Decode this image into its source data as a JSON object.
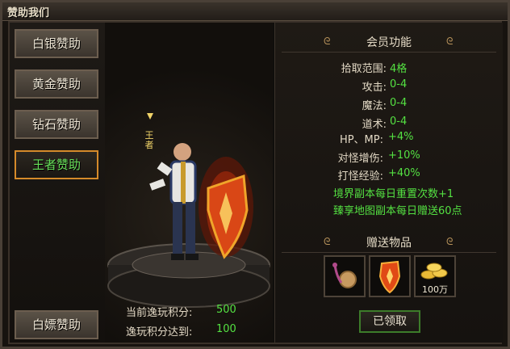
{
  "window": {
    "title": "赞助我们"
  },
  "tiers": [
    {
      "label": "白银赞助",
      "active": false
    },
    {
      "label": "黄金赞助",
      "active": false
    },
    {
      "label": "钻石赞助",
      "active": false
    },
    {
      "label": "王者赞助",
      "active": true
    }
  ],
  "free_tier": {
    "label": "白嫖赞助"
  },
  "character": {
    "title_badge": "王者"
  },
  "score": {
    "current_label": "当前逸玩积分:",
    "current_value": "500",
    "target_label": "逸玩积分达到:",
    "target_value": "100"
  },
  "member": {
    "heading": "会员功能",
    "stats": [
      {
        "label": "拾取范围:",
        "value": "4格"
      },
      {
        "label": "攻击:",
        "value": "0-4"
      },
      {
        "label": "魔法:",
        "value": "0-4"
      },
      {
        "label": "道术:",
        "value": "0-4"
      },
      {
        "label": "HP、MP:",
        "value": "+4%"
      },
      {
        "label": "对怪增伤:",
        "value": "+10%"
      },
      {
        "label": "打怪经验:",
        "value": "+40%"
      }
    ],
    "perks": [
      "境界副本每日重置次数+1",
      "臻享地图副本每日赠送60点"
    ]
  },
  "gifts": {
    "heading": "赠送物品",
    "items": [
      {
        "icon": "amulet-icon",
        "qty": ""
      },
      {
        "icon": "shield-icon",
        "qty": ""
      },
      {
        "icon": "gold-coins-icon",
        "qty": "100万"
      }
    ]
  },
  "claim": {
    "label": "已领取"
  },
  "colors": {
    "accent_green": "#54e142",
    "active_border": "#d58a2a"
  }
}
